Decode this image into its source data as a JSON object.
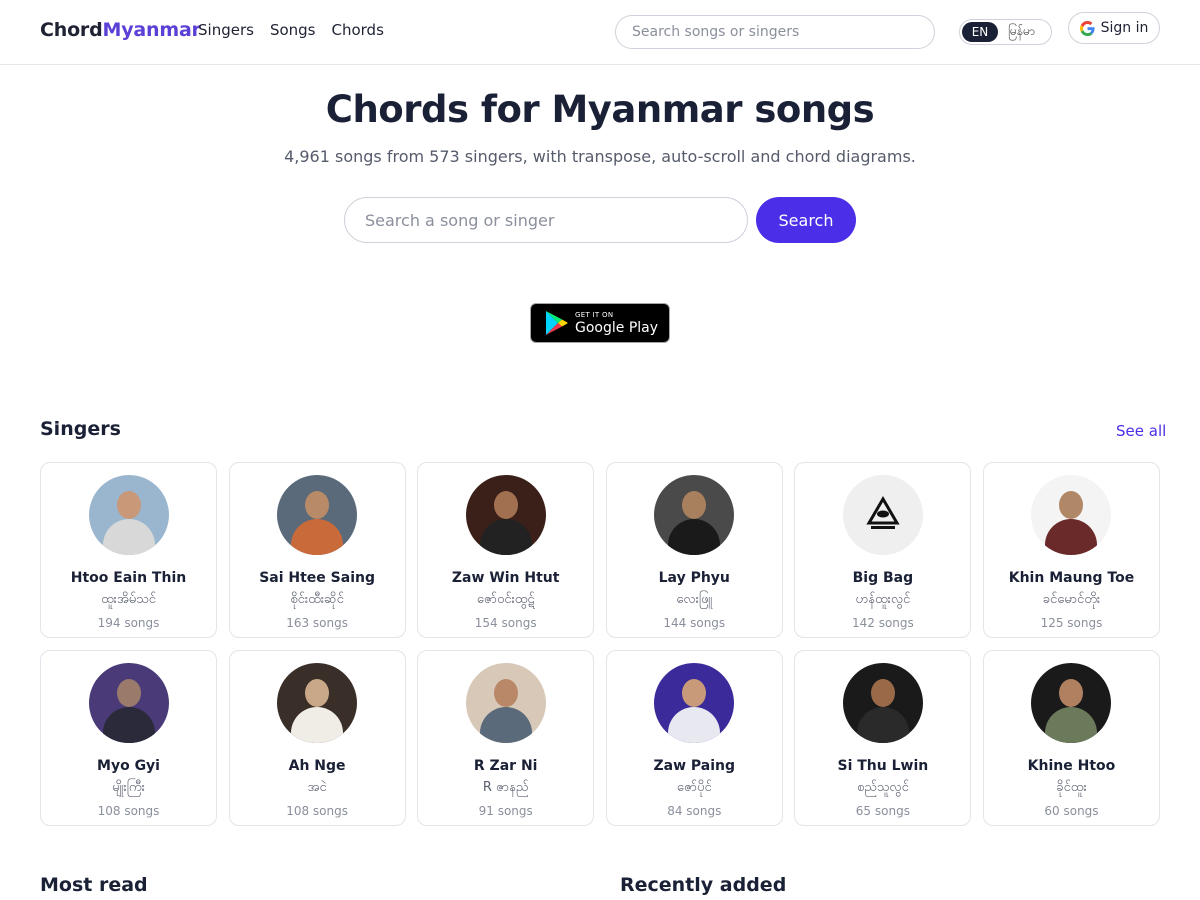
{
  "header": {
    "logo_part1": "Chord",
    "logo_part2": "Myanmar",
    "nav": [
      "Singers",
      "Songs",
      "Chords"
    ],
    "search_placeholder": "Search songs or singers",
    "lang_en": "EN",
    "lang_my": "မြန်မာ",
    "signin_label": "Sign in"
  },
  "hero": {
    "title": "Chords for Myanmar songs",
    "subtitle": "4,961 songs from 573 singers, with transpose, auto-scroll and chord diagrams.",
    "search_placeholder": "Search a song or singer",
    "search_button": "Search"
  },
  "google_play": {
    "small": "GET IT ON",
    "big": "Google Play"
  },
  "singers": {
    "title": "Singers",
    "see_all": "See all",
    "items": [
      {
        "name": "Htoo Eain Thin",
        "mm": "ထူးအိမ်သင်",
        "count": "194 songs",
        "bg": "#9ab6cf",
        "skin": "#c89878",
        "cloth": "#d8d8d8"
      },
      {
        "name": "Sai Htee Saing",
        "mm": "စိုင်းထီးဆိုင်",
        "count": "163 songs",
        "bg": "#5a6a7a",
        "skin": "#b88a68",
        "cloth": "#c96a3a"
      },
      {
        "name": "Zaw Win Htut",
        "mm": "ဇော်ဝင်းထွဋ်",
        "count": "154 songs",
        "bg": "#3a2018",
        "skin": "#a07050",
        "cloth": "#222222"
      },
      {
        "name": "Lay Phyu",
        "mm": "လေးဖြူ",
        "count": "144 songs",
        "bg": "#4a4a4a",
        "skin": "#a8805e",
        "cloth": "#1a1a1a"
      },
      {
        "name": "Big Bag",
        "mm": "ဟန်ထူးလွင်",
        "count": "142 songs",
        "bg": "#eeeeee",
        "skin": "#eeeeee",
        "cloth": "#eeeeee"
      },
      {
        "name": "Khin Maung Toe",
        "mm": "ခင်မောင်တိုး",
        "count": "125 songs",
        "bg": "#f4f4f4",
        "skin": "#b08868",
        "cloth": "#6a2a2a"
      },
      {
        "name": "Myo Gyi",
        "mm": "မျိုးကြီး",
        "count": "108 songs",
        "bg": "#4a3a78",
        "skin": "#9a7a6a",
        "cloth": "#2a2a3a"
      },
      {
        "name": "Ah Nge",
        "mm": "အငဲ",
        "count": "108 songs",
        "bg": "#3a2e28",
        "skin": "#c8a888",
        "cloth": "#f0ece6"
      },
      {
        "name": "R Zar Ni",
        "mm": "R ဇာနည်",
        "count": "91 songs",
        "bg": "#d8c8b8",
        "skin": "#b88868",
        "cloth": "#5a6a7a"
      },
      {
        "name": "Zaw Paing",
        "mm": "ဇော်ပိုင်",
        "count": "84 songs",
        "bg": "#3a2a9a",
        "skin": "#c89a7a",
        "cloth": "#e8e8f0"
      },
      {
        "name": "Si Thu Lwin",
        "mm": "စည်သူလွင်",
        "count": "65 songs",
        "bg": "#1a1a1a",
        "skin": "#9a6a48",
        "cloth": "#2a2a2a"
      },
      {
        "name": "Khine Htoo",
        "mm": "ခိုင်ထူး",
        "count": "60 songs",
        "bg": "#1a1a1a",
        "skin": "#b08060",
        "cloth": "#6a7a5a"
      }
    ]
  },
  "sections": {
    "most_read": "Most read",
    "recently_added": "Recently added"
  }
}
